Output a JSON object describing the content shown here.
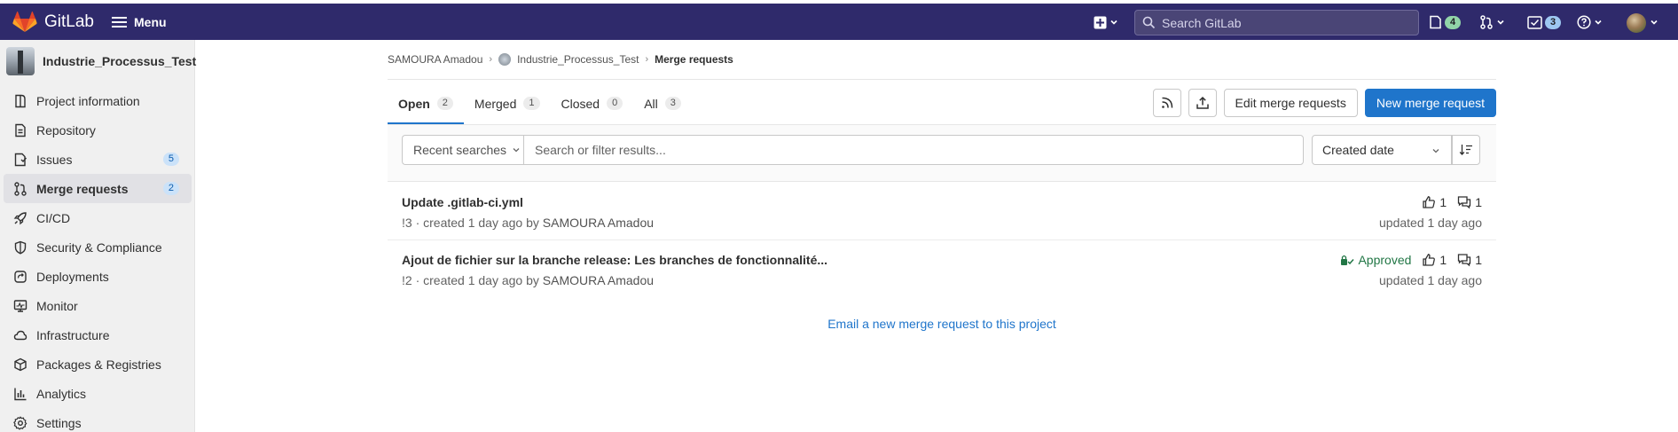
{
  "topbar": {
    "brand": "GitLab",
    "menu_label": "Menu",
    "search_placeholder": "Search GitLab",
    "issues_count": "4",
    "todos_count": "3",
    "icons": [
      "gitlab-logo-icon",
      "hamburger-icon",
      "plus-square-icon",
      "search-icon",
      "issues-icon",
      "merge-request-icon",
      "todo-icon",
      "help-icon",
      "avatar"
    ]
  },
  "sidebar": {
    "project_name": "Industrie_Processus_Test",
    "items": [
      {
        "label": "Project information",
        "icon": "project-info-icon"
      },
      {
        "label": "Repository",
        "icon": "repository-icon"
      },
      {
        "label": "Issues",
        "icon": "issues-icon",
        "count": "5"
      },
      {
        "label": "Merge requests",
        "icon": "merge-request-icon",
        "count": "2",
        "active": true
      },
      {
        "label": "CI/CD",
        "icon": "rocket-icon"
      },
      {
        "label": "Security & Compliance",
        "icon": "shield-icon"
      },
      {
        "label": "Deployments",
        "icon": "deployments-icon"
      },
      {
        "label": "Monitor",
        "icon": "monitor-icon"
      },
      {
        "label": "Infrastructure",
        "icon": "cloud-icon"
      },
      {
        "label": "Packages & Registries",
        "icon": "package-icon"
      },
      {
        "label": "Analytics",
        "icon": "chart-icon"
      },
      {
        "label": "Settings",
        "icon": "gear-icon"
      }
    ]
  },
  "breadcrumb": {
    "user": "SAMOURA Amadou",
    "project": "Industrie_Processus_Test",
    "current": "Merge requests"
  },
  "tabs": [
    {
      "label": "Open",
      "count": "2"
    },
    {
      "label": "Merged",
      "count": "1"
    },
    {
      "label": "Closed",
      "count": "0"
    },
    {
      "label": "All",
      "count": "3"
    }
  ],
  "actions": {
    "edit_label": "Edit merge requests",
    "new_label": "New merge request"
  },
  "filter": {
    "recent_label": "Recent searches",
    "placeholder": "Search or filter results...",
    "sort_label": "Created date"
  },
  "merge_requests": [
    {
      "title": "Update .gitlab-ci.yml",
      "meta": "!3 · created 1 day ago by",
      "author": "SAMOURA Amadou",
      "upvotes": "1",
      "comments": "1",
      "approved": "",
      "updated": "updated 1 day ago"
    },
    {
      "title": "Ajout de fichier sur la branche release: Les branches de fonctionnalité...",
      "meta": "!2 · created 1 day ago by",
      "author": "SAMOURA Amadou",
      "upvotes": "1",
      "comments": "1",
      "approved": "Approved",
      "updated": "updated 1 day ago"
    }
  ],
  "email_link": "Email a new merge request to this project",
  "colors": {
    "topbar": "#2f2a6b",
    "primary": "#1f75cb",
    "approved": "#217645"
  }
}
